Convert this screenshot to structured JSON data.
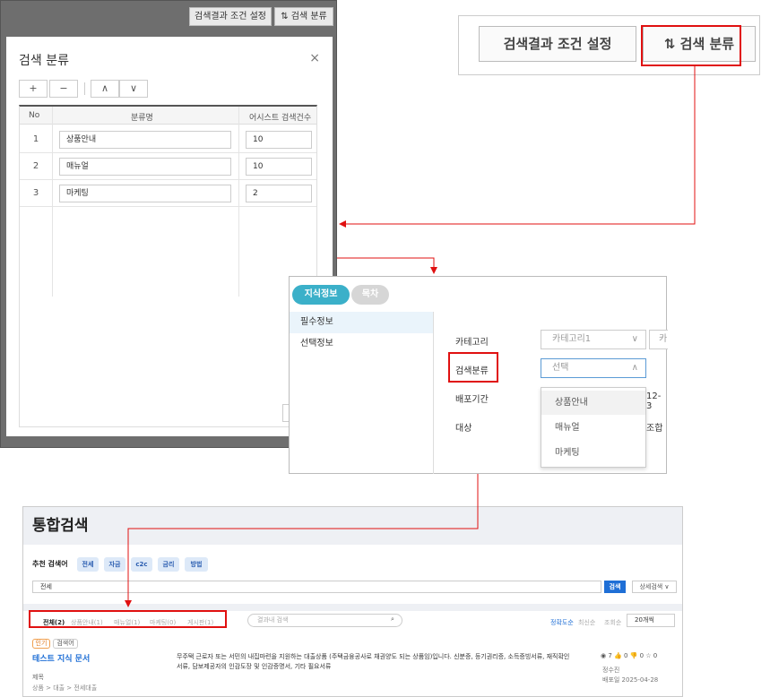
{
  "p1": {
    "btn_conditions": "검색결과 조건 설정",
    "btn_classes": "⇅ 검색 분류",
    "modal_title": "검색 분류",
    "close": "×",
    "tool_add": "+",
    "tool_remove": "−",
    "tool_up": "∧",
    "tool_down": "∨",
    "col_no": "No",
    "col_name": "분류명",
    "col_count": "어시스트 검색건수",
    "rows": [
      {
        "no": "1",
        "name": "상품안내",
        "count": "10"
      },
      {
        "no": "2",
        "name": "매뉴얼",
        "count": "10"
      },
      {
        "no": "3",
        "name": "마케팅",
        "count": "2"
      }
    ]
  },
  "p2": {
    "btn_conditions": "검색결과 조건 설정",
    "btn_classes": "⇅ 검색 분류"
  },
  "p3": {
    "tab_info": "지식정보",
    "tab_toc": "목차",
    "side_required": "필수정보",
    "side_optional": "선택정보",
    "lbl_category": "카테고리",
    "category_value": "카테고리1",
    "category_more": "카",
    "lbl_search_class": "검색분류",
    "search_class_placeholder": "선택",
    "lbl_period": "배포기간",
    "period_partial": "12-3",
    "lbl_target": "대상",
    "target_partial": "조합",
    "options": [
      "상품안내",
      "매뉴얼",
      "마케팅"
    ]
  },
  "p4": {
    "title": "통합검색",
    "recommend_label": "추천 검색어",
    "recommend_tags": [
      "전세",
      "자금",
      "c2c",
      "금리",
      "방법"
    ],
    "search_value": "전세",
    "search_button": "검색",
    "advanced": "상세검색 ∨",
    "tabs": [
      "전체(2)",
      "상품안내(1)",
      "매뉴얼(1)",
      "마케팅(0)",
      "게시판(1)"
    ],
    "result_search_placeholder": "결과내 검색",
    "sort": [
      "정확도순",
      "최신순",
      "조회순"
    ],
    "page_size": "20개씩",
    "badge_hot": "인기",
    "badge_class": "검색어",
    "result_title": "테스트 지식 문서",
    "result_desc": "무주택 근로자 또는 서민의 내집마련을 지원하는 대출상품 (주택금융공사로 채권양도 되는 상품임)입니다. 신분증, 등기권리증, 소득증빙서류, 재직확인서류, 담보제공자의 인감도장 및 인감증명서, 기타 필요서류",
    "result_sub": "제목",
    "result_path": "상품 > 대출 > 전세대출",
    "stats": "◉ 7 👍 0 👎 0 ☆ 0",
    "author": "정수진",
    "date": "배포일 2025-04-28"
  },
  "colors": {
    "highlight": "#e01010",
    "pill_active": "#3bb0c9",
    "search_button": "#1f6fd6"
  }
}
